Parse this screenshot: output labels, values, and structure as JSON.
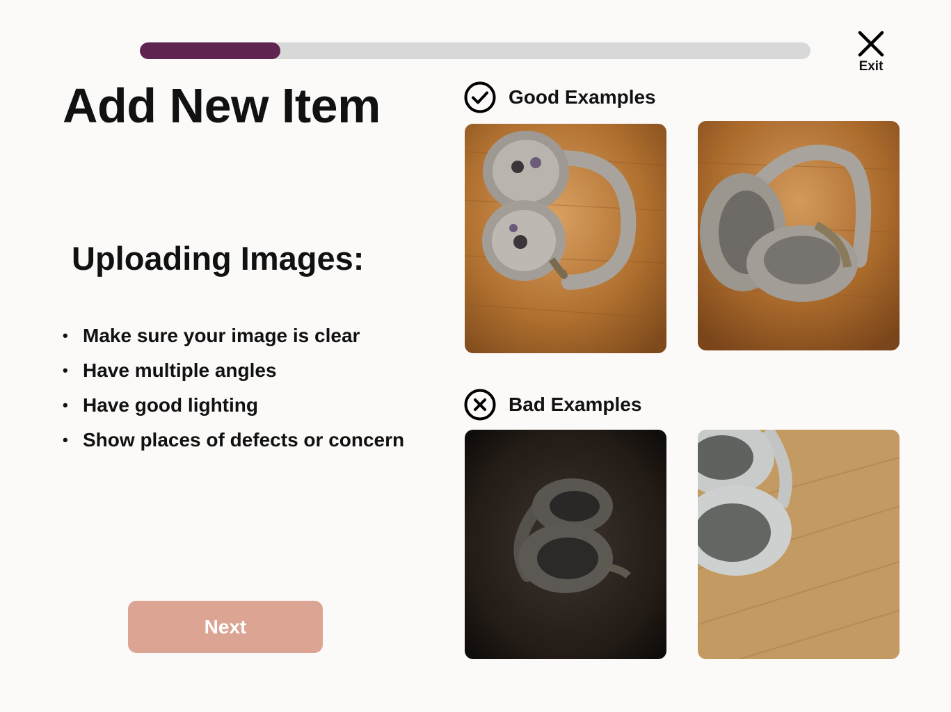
{
  "progress": {
    "value": 0.21
  },
  "header": {
    "exit_label": "Exit"
  },
  "page": {
    "title": "Add New Item",
    "subtitle": "Uploading Images:",
    "tips": [
      "Make sure your image is clear",
      "Have multiple angles",
      "Have good lighting",
      "Show places of defects or concern"
    ],
    "next_label": "Next"
  },
  "examples": {
    "good": {
      "heading": "Good Examples",
      "icon": "check-circle-icon",
      "photos": [
        "headphones-folded-stickers-photo",
        "headphones-earcups-up-photo"
      ]
    },
    "bad": {
      "heading": "Bad Examples",
      "icon": "x-circle-icon",
      "photos": [
        "headphones-dark-photo",
        "headphones-cropped-photo"
      ]
    }
  },
  "colors": {
    "background": "#fcfaf9",
    "progress_fill": "#5f2450",
    "progress_track": "#d8d8d8",
    "next_button": "#dca493",
    "wood": "#b5773a"
  }
}
